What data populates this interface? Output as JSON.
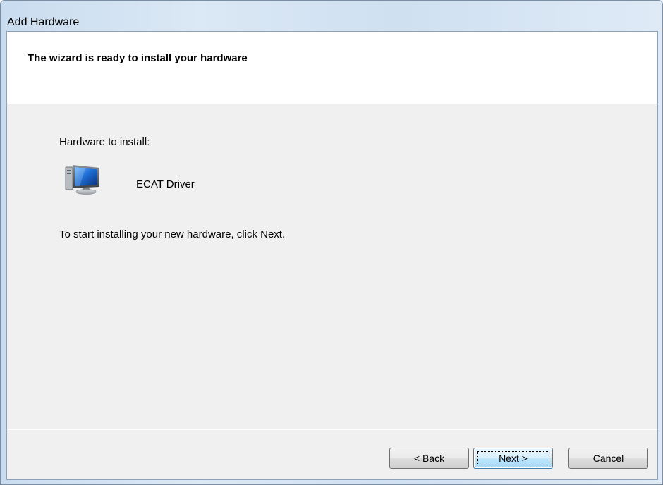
{
  "window": {
    "title": "Add Hardware"
  },
  "header": {
    "title": "The wizard is ready to install your hardware"
  },
  "content": {
    "section_label": "Hardware to install:",
    "device_name": "ECAT Driver",
    "device_icon": "monitor-icon",
    "instruction": "To start installing your new hardware, click Next."
  },
  "buttons": {
    "back_label": "< Back",
    "next_label": "Next >",
    "cancel_label": "Cancel"
  },
  "colors": {
    "client_background": "#f0f0f0",
    "header_background": "#ffffff",
    "default_button_border": "#3c7fb1"
  }
}
